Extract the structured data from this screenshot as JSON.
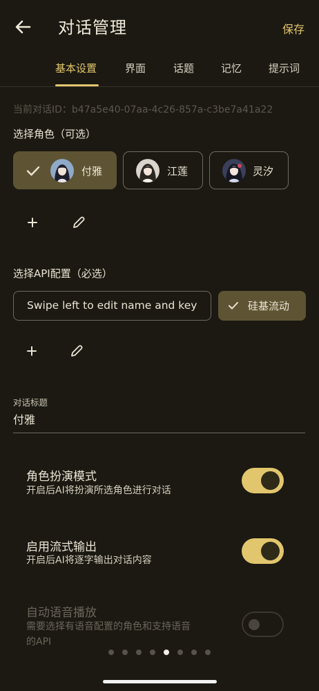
{
  "header": {
    "title": "对话管理",
    "save_label": "保存"
  },
  "tabs": [
    {
      "label": "基本设置",
      "active": true
    },
    {
      "label": "界面",
      "active": false
    },
    {
      "label": "话题",
      "active": false
    },
    {
      "label": "记忆",
      "active": false
    },
    {
      "label": "提示词",
      "active": false
    }
  ],
  "conversation_id_text": "当前对话ID：b47a5e40-07aa-4c26-857a-c3be7a41a22",
  "roles": {
    "label": "选择角色（可选）",
    "items": [
      {
        "name": "付雅",
        "selected": true
      },
      {
        "name": "江莲",
        "selected": false
      },
      {
        "name": "灵汐",
        "selected": false
      }
    ]
  },
  "api": {
    "label": "选择API配置（必选）",
    "hint": "Swipe left to edit name and key",
    "selected_name": "硅基流动"
  },
  "conversation_title": {
    "label": "对话标题",
    "value": "付雅"
  },
  "settings": [
    {
      "title": "角色扮演模式",
      "desc": "开启后AI将扮演所选角色进行对话",
      "enabled": true,
      "on": true
    },
    {
      "title": "启用流式输出",
      "desc": "开启后AI将逐字输出对话内容",
      "enabled": true,
      "on": true
    },
    {
      "title": "自动语音播放",
      "desc": "需要选择有语音配置的角色和支持语音",
      "desc2": "的API",
      "enabled": false,
      "on": false
    }
  ],
  "pager": {
    "total": 8,
    "active_index": 4
  },
  "colors": {
    "accent": "#e2c66d",
    "background": "#1b1912",
    "selected_chip": "#5e5433"
  }
}
